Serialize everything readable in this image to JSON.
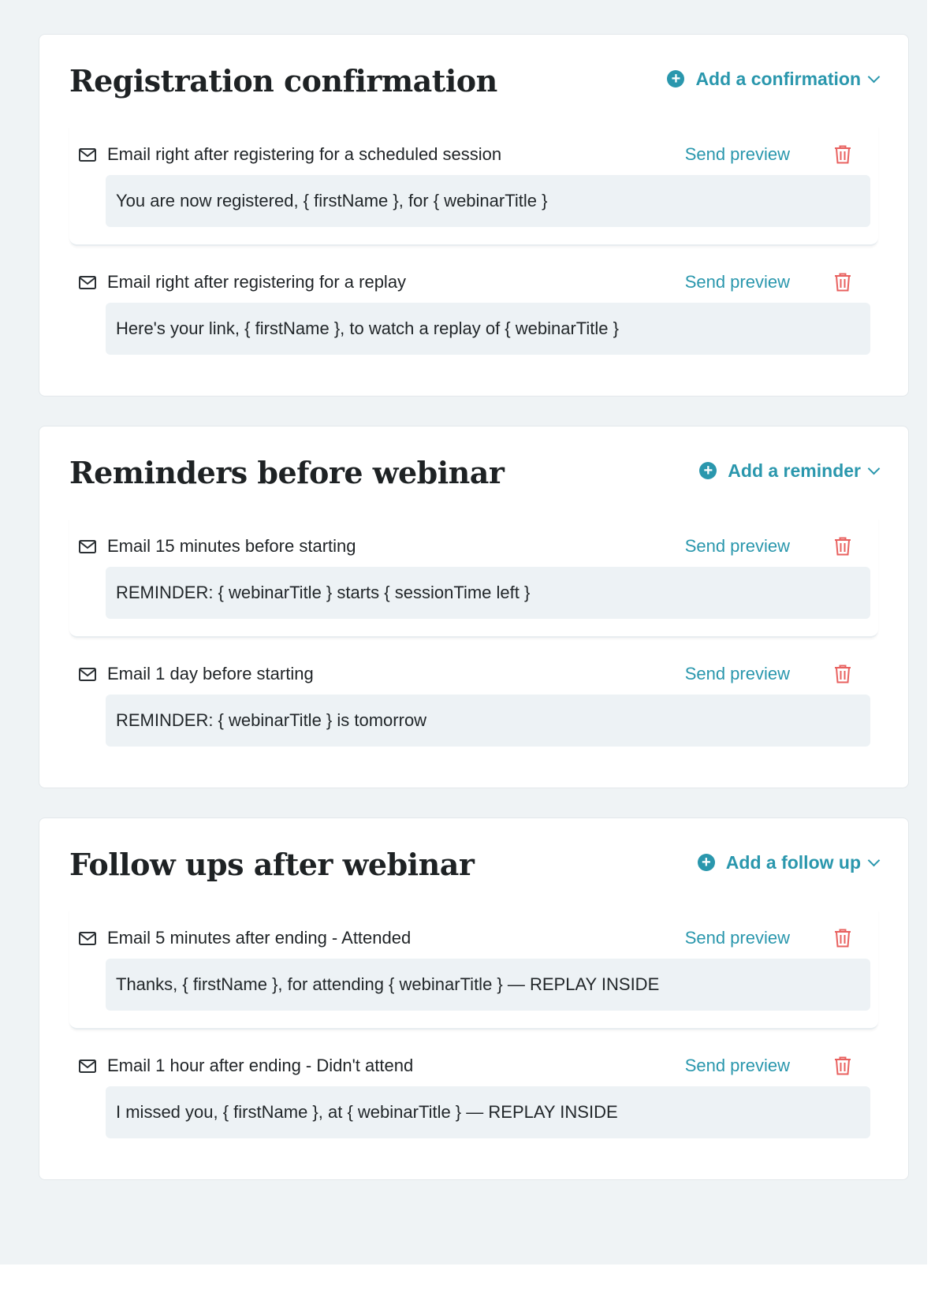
{
  "sections": [
    {
      "title": "Registration confirmation",
      "add_label": "Add a confirmation",
      "emails": [
        {
          "label": "Email right after registering for a scheduled session",
          "preview": "Send preview",
          "subject": "You are now registered, { firstName }, for { webinarTitle }"
        },
        {
          "label": "Email right after registering for a replay",
          "preview": "Send preview",
          "subject": "Here's your link, { firstName }, to watch a replay of { webinarTitle }"
        }
      ]
    },
    {
      "title": "Reminders before webinar",
      "add_label": "Add a reminder",
      "emails": [
        {
          "label": "Email 15 minutes before starting",
          "preview": "Send preview",
          "subject": "REMINDER: { webinarTitle } starts { sessionTime left }"
        },
        {
          "label": "Email 1 day before starting",
          "preview": "Send preview",
          "subject": "REMINDER: { webinarTitle } is tomorrow"
        }
      ]
    },
    {
      "title": "Follow ups after webinar",
      "add_label": "Add a follow up",
      "emails": [
        {
          "label": "Email 5 minutes after ending - Attended",
          "preview": "Send preview",
          "subject": "Thanks, { firstName }, for attending { webinarTitle } — REPLAY INSIDE"
        },
        {
          "label": "Email 1 hour after ending - Didn't attend",
          "preview": "Send preview",
          "subject": "I missed you, { firstName }, at { webinarTitle } — REPLAY INSIDE"
        }
      ]
    }
  ],
  "icons": {
    "mail": "mail-icon",
    "trash": "trash-icon",
    "plus": "plus-circle-icon",
    "chevron": "chevron-down-icon"
  },
  "colors": {
    "accent": "#2a97ad",
    "danger": "#e8615f",
    "background": "#eff3f5",
    "subject_bg": "#edf2f5"
  }
}
